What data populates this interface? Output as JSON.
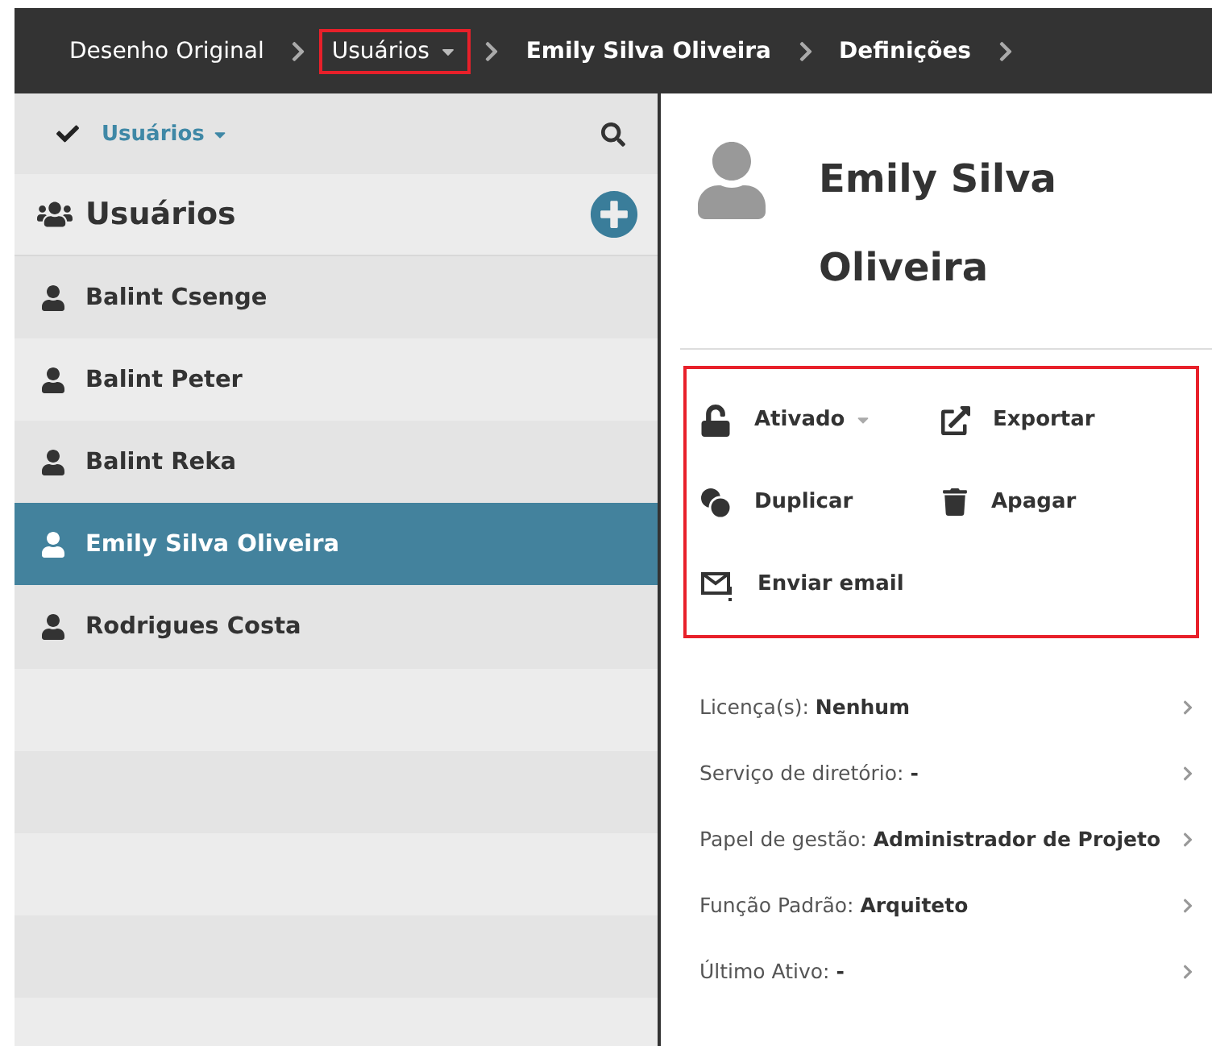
{
  "breadcrumb": [
    {
      "label": "Desenho Original",
      "bold": false,
      "highlighted": false,
      "dropdown": false
    },
    {
      "label": "Usuários",
      "bold": false,
      "highlighted": true,
      "dropdown": true
    },
    {
      "label": "Emily Silva Oliveira",
      "bold": true,
      "highlighted": false,
      "dropdown": false
    },
    {
      "label": "Definições",
      "bold": true,
      "highlighted": false,
      "dropdown": false
    }
  ],
  "sidebar": {
    "filter": {
      "label": "Usuários",
      "checked": true
    },
    "heading": "Usuários",
    "items": [
      {
        "name": "Balint Csenge",
        "selected": false
      },
      {
        "name": "Balint Peter",
        "selected": false
      },
      {
        "name": "Balint Reka",
        "selected": false
      },
      {
        "name": "Emily Silva Oliveira",
        "selected": true
      },
      {
        "name": "Rodrigues Costa",
        "selected": false
      }
    ]
  },
  "detail": {
    "name": "Emily Silva Oliveira",
    "actions_highlighted": true,
    "actions": [
      {
        "kind": "status",
        "label": "Ativado",
        "dropdown": true
      },
      {
        "kind": "export",
        "label": "Exportar",
        "dropdown": false
      },
      {
        "kind": "duplicate",
        "label": "Duplicar",
        "dropdown": false
      },
      {
        "kind": "delete",
        "label": "Apagar",
        "dropdown": false
      },
      {
        "kind": "email",
        "label": "Enviar email",
        "dropdown": false
      }
    ],
    "properties": [
      {
        "text": "Licença(s): **Nenhum**"
      },
      {
        "text": "Serviço de diretório: **-**"
      },
      {
        "text": "Papel de gestão: **Administrador de Projeto**"
      },
      {
        "text": "Função Padrão: **Arquiteto**"
      },
      {
        "text": "Último Ativo: **-**"
      }
    ]
  }
}
